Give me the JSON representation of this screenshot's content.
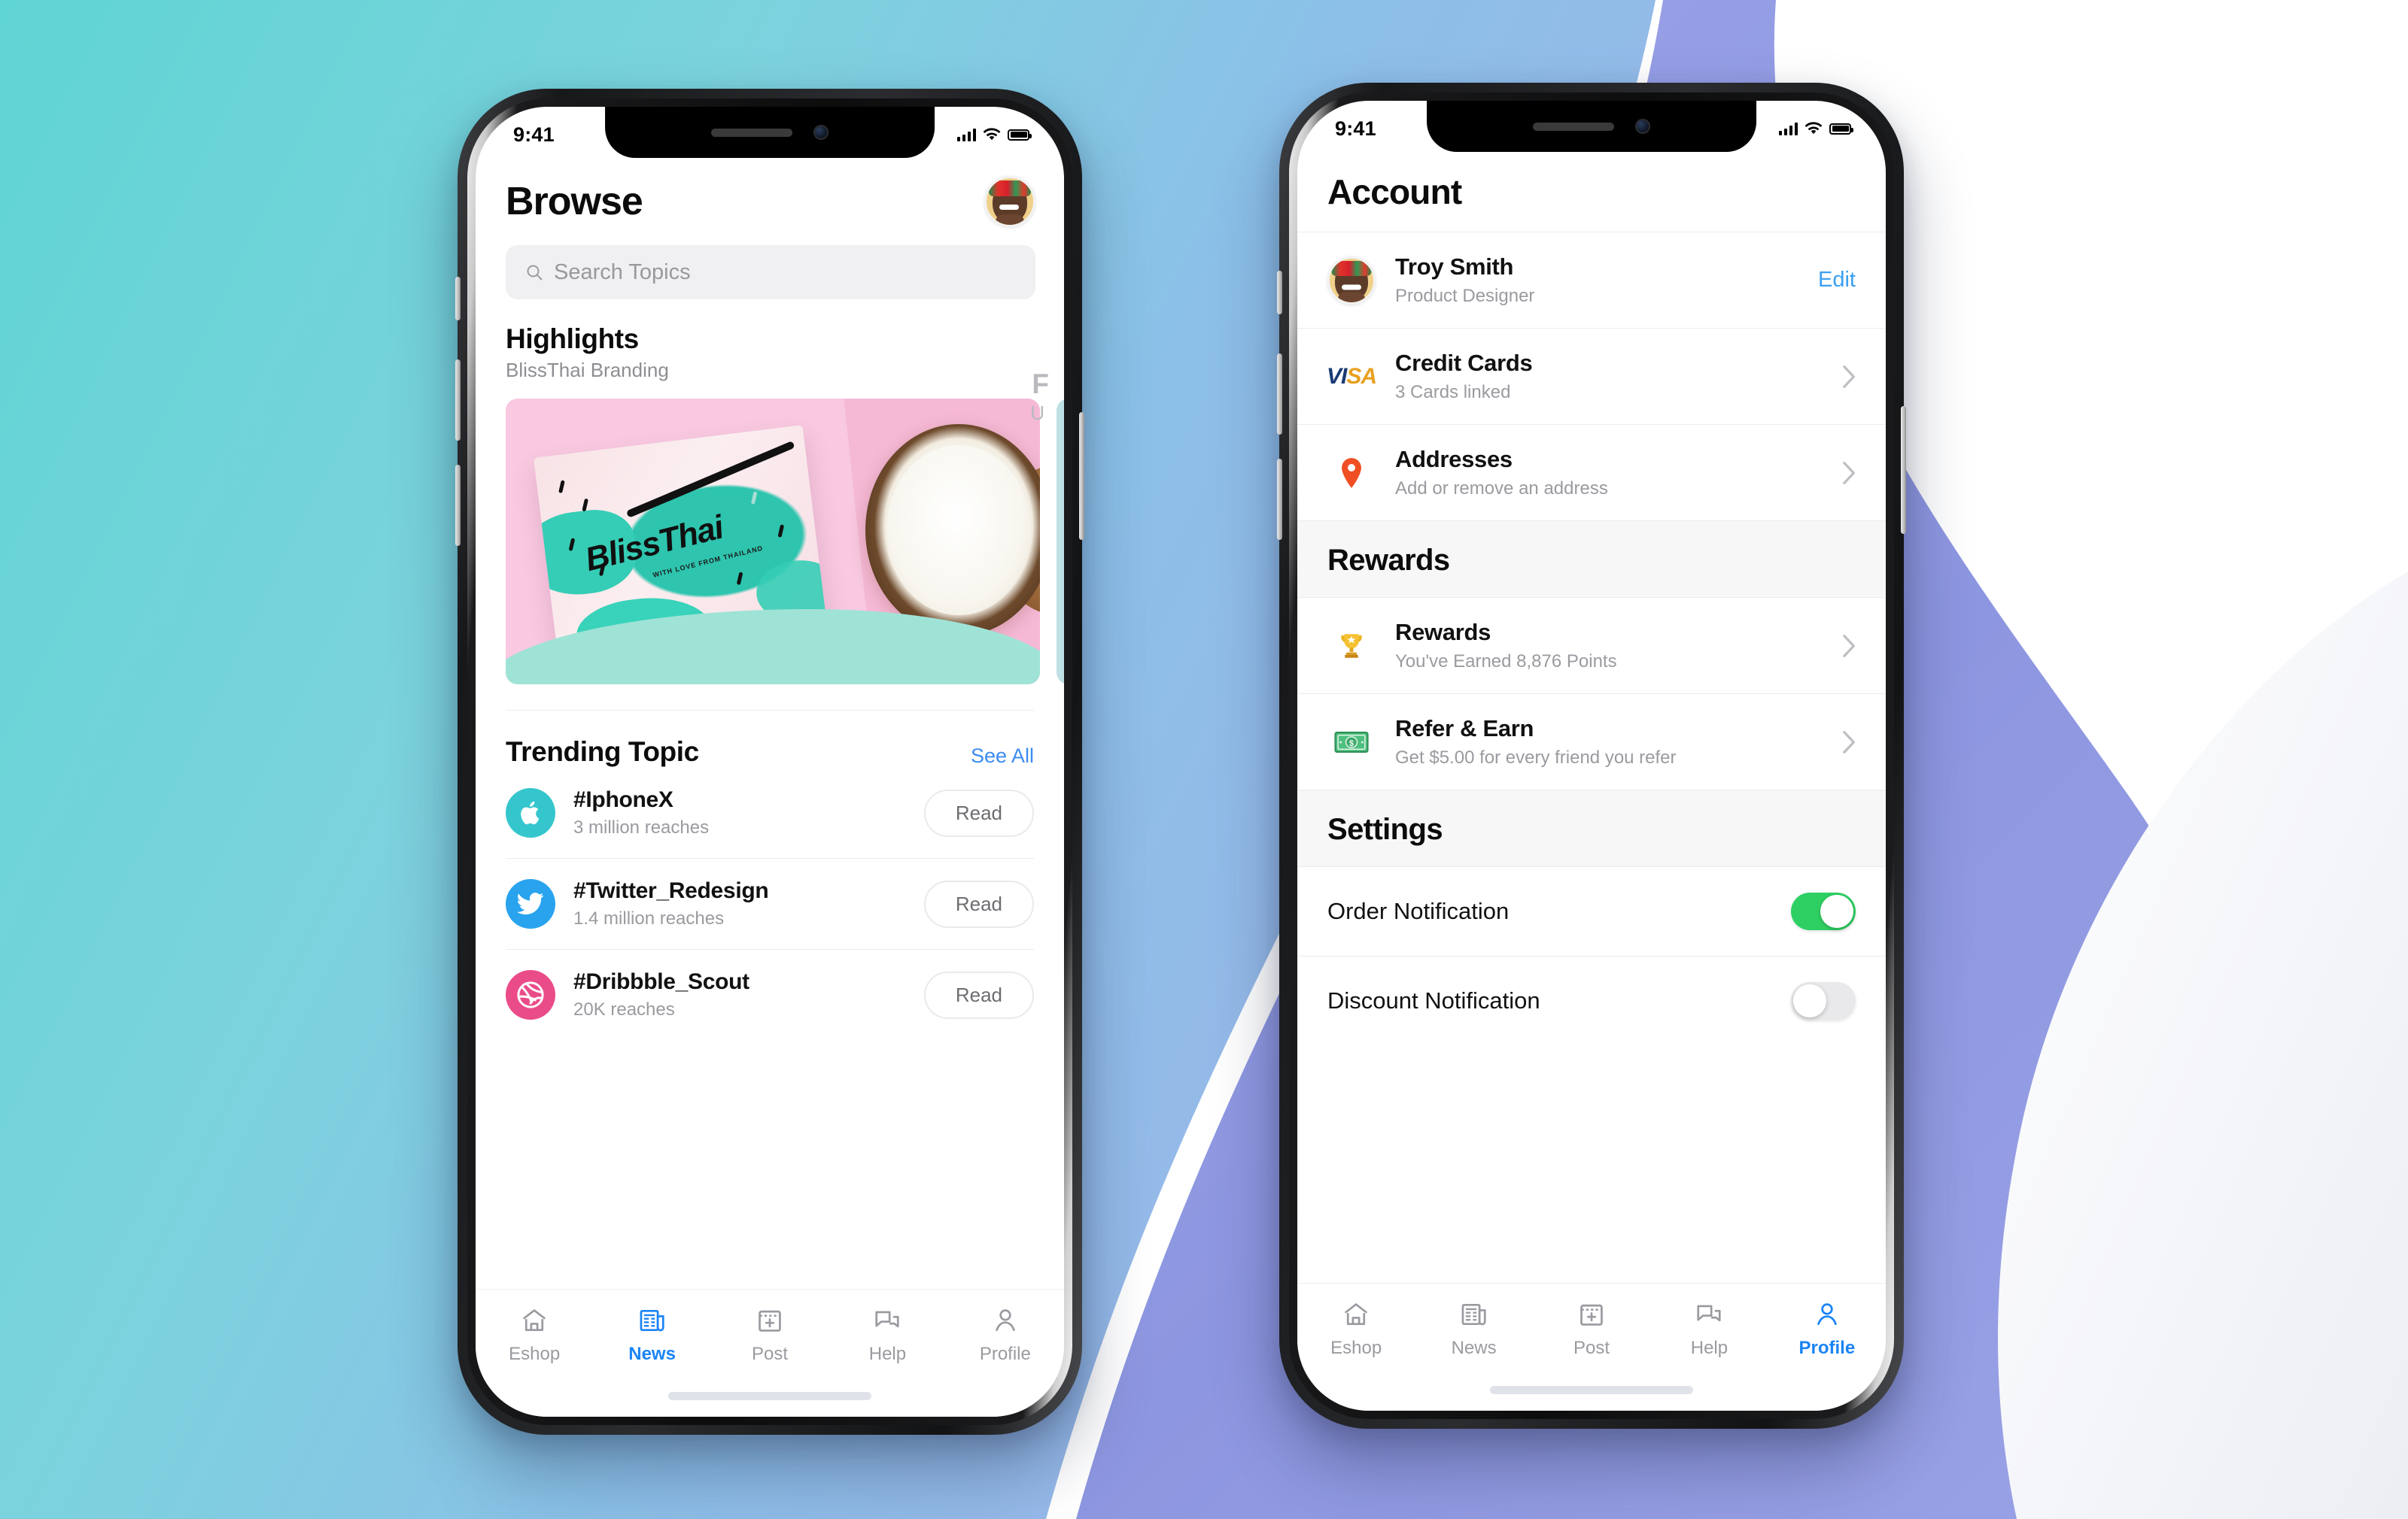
{
  "theme": {
    "accent_blue": "#1a84f5",
    "link_blue": "#3b8cf0",
    "toggle_green": "#2fd063",
    "bg_teal": "#6fd0d8",
    "bg_blue": "#8fb4e6",
    "bg_periwinkle": "#8d96e0"
  },
  "phone1": {
    "status": {
      "time": "9:41",
      "signal_icon": "cellular-bars-icon",
      "wifi_icon": "wifi-icon",
      "battery_icon": "battery-full-icon"
    },
    "header": {
      "title": "Browse",
      "avatar_name": "user-avatar"
    },
    "search": {
      "placeholder": "Search Topics",
      "icon": "search-icon"
    },
    "highlights": {
      "title": "Highlights",
      "subtitle": "BlissThai Branding",
      "card_brand_text": "BlissThai",
      "card_brand_tagline": "WITH LOVE FROM THAILAND",
      "next_card_title": "F",
      "next_card_sub": "U"
    },
    "trending": {
      "title": "Trending Topic",
      "see_all": "See All",
      "items": [
        {
          "icon": "apple-icon",
          "icon_color": "#35c6cd",
          "name": "#IphoneX",
          "reach": "3 million reaches",
          "action": "Read"
        },
        {
          "icon": "twitter-icon",
          "icon_color": "#2aa3ef",
          "name": "#Twitter_Redesign",
          "reach": "1.4 million reaches",
          "action": "Read"
        },
        {
          "icon": "dribbble-icon",
          "icon_color": "#ea4c89",
          "name": "#Dribbble_Scout",
          "reach": "20K reaches",
          "action": "Read"
        }
      ]
    },
    "tabs": [
      {
        "icon": "home-icon",
        "label": "Eshop",
        "active": false
      },
      {
        "icon": "newspaper-icon",
        "label": "News",
        "active": true
      },
      {
        "icon": "calendar-plus-icon",
        "label": "Post",
        "active": false
      },
      {
        "icon": "chat-bubbles-icon",
        "label": "Help",
        "active": false
      },
      {
        "icon": "person-icon",
        "label": "Profile",
        "active": false
      }
    ]
  },
  "phone2": {
    "status": {
      "time": "9:41",
      "signal_icon": "cellular-bars-icon",
      "wifi_icon": "wifi-icon",
      "battery_icon": "battery-full-icon"
    },
    "header": {
      "title": "Account"
    },
    "profile": {
      "name": "Troy Smith",
      "role": "Product Designer",
      "edit_label": "Edit",
      "avatar_name": "user-avatar"
    },
    "account_rows": [
      {
        "icon": "visa-logo-icon",
        "title": "Credit Cards",
        "sub": "3 Cards linked",
        "chevron": "chevron-right-icon"
      },
      {
        "icon": "map-pin-icon",
        "title": "Addresses",
        "sub": "Add or remove an address",
        "chevron": "chevron-right-icon"
      }
    ],
    "rewards_section": {
      "heading": "Rewards",
      "rows": [
        {
          "icon": "trophy-icon",
          "title": "Rewards",
          "sub": "You've Earned 8,876 Points",
          "chevron": "chevron-right-icon"
        },
        {
          "icon": "money-icon",
          "title": "Refer & Earn",
          "sub": "Get $5.00 for every friend you refer",
          "chevron": "chevron-right-icon"
        }
      ]
    },
    "settings_section": {
      "heading": "Settings",
      "toggles": [
        {
          "label": "Order Notification",
          "state": "on"
        },
        {
          "label": "Discount Notification",
          "state": "off"
        }
      ]
    },
    "tabs": [
      {
        "icon": "home-icon",
        "label": "Eshop",
        "active": false
      },
      {
        "icon": "newspaper-icon",
        "label": "News",
        "active": false
      },
      {
        "icon": "calendar-plus-icon",
        "label": "Post",
        "active": false
      },
      {
        "icon": "chat-bubbles-icon",
        "label": "Help",
        "active": false
      },
      {
        "icon": "person-icon",
        "label": "Profile",
        "active": true
      }
    ]
  }
}
